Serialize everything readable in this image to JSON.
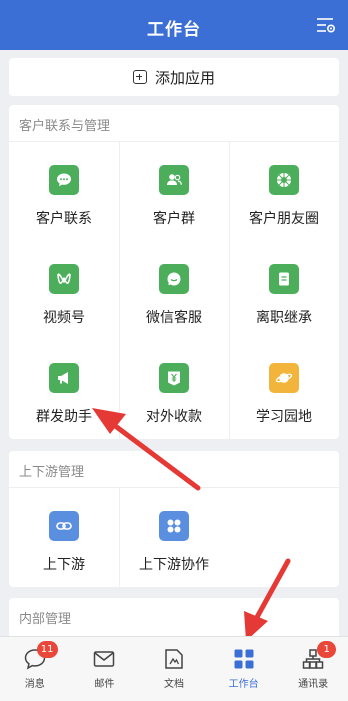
{
  "header": {
    "title": "工作台"
  },
  "add_app": {
    "label": "添加应用"
  },
  "sections": [
    {
      "title": "客户联系与管理",
      "items": [
        {
          "label": "客户联系",
          "icon": "chat-bubble-icon",
          "color": "#4cae5a"
        },
        {
          "label": "客户群",
          "icon": "group-icon",
          "color": "#4cae5a"
        },
        {
          "label": "客户朋友圈",
          "icon": "moments-aperture-icon",
          "color": "#4cae5a"
        },
        {
          "label": "视频号",
          "icon": "channels-icon",
          "color": "#4cae5a"
        },
        {
          "label": "微信客服",
          "icon": "service-chat-icon",
          "color": "#4cae5a"
        },
        {
          "label": "离职继承",
          "icon": "document-icon",
          "color": "#4cae5a"
        },
        {
          "label": "群发助手",
          "icon": "megaphone-icon",
          "color": "#4cae5a"
        },
        {
          "label": "对外收款",
          "icon": "yuan-receipt-icon",
          "color": "#4cae5a"
        },
        {
          "label": "学习园地",
          "icon": "planet-icon",
          "color": "#f2b43a"
        }
      ]
    },
    {
      "title": "上下游管理",
      "items": [
        {
          "label": "上下游",
          "icon": "link-icon",
          "color": "#5a8fe0"
        },
        {
          "label": "上下游协作",
          "icon": "four-dots-icon",
          "color": "#5a8fe0"
        }
      ]
    },
    {
      "title": "内部管理",
      "items": []
    }
  ],
  "tabbar": [
    {
      "label": "消息",
      "icon": "message-icon",
      "badge": "11"
    },
    {
      "label": "邮件",
      "icon": "mail-icon",
      "badge": ""
    },
    {
      "label": "文档",
      "icon": "doc-icon",
      "badge": ""
    },
    {
      "label": "工作台",
      "icon": "workbench-grid-icon",
      "badge": "",
      "active": true
    },
    {
      "label": "通讯录",
      "icon": "contacts-icon",
      "badge": "1"
    }
  ],
  "colors": {
    "brand": "#3c6fd6",
    "green": "#4cae5a",
    "badge": "#e8473a",
    "arrow": "#e53935"
  }
}
